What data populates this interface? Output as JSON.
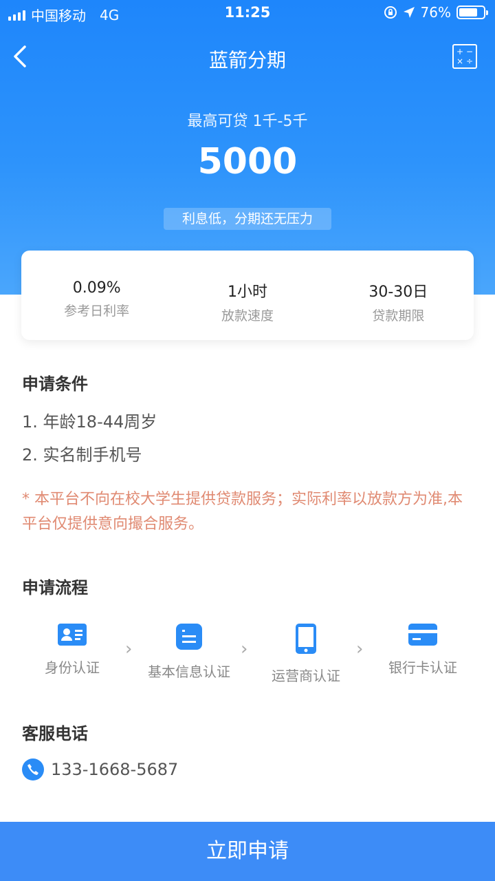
{
  "status_bar": {
    "carrier": "中国移动",
    "network": "4G",
    "time": "11:25",
    "battery": "76%",
    "battery_level": 0.76
  },
  "nav": {
    "title": "蓝箭分期"
  },
  "hero": {
    "subtitle": "最高可贷 1千-5千",
    "amount": "5000",
    "slogan": "利息低，分期还无压力"
  },
  "stats": [
    {
      "value": "0.09%",
      "label": "参考日利率"
    },
    {
      "value": "1小时",
      "label": "放款速度"
    },
    {
      "value": "30-30日",
      "label": "贷款期限"
    }
  ],
  "conditions": {
    "title": "申请条件",
    "items": [
      "1. 年龄18-44周岁",
      "2. 实名制手机号"
    ]
  },
  "notice": "* 本平台不向在校大学生提供贷款服务；实际利率以放款方为准,本平台仅提供意向撮合服务。",
  "process": {
    "title": "申请流程",
    "steps": [
      {
        "label": "身份认证",
        "icon": "id-card-icon"
      },
      {
        "label": "基本信息认证",
        "icon": "info-list-icon"
      },
      {
        "label": "运营商认证",
        "icon": "mobile-phone-icon"
      },
      {
        "label": "银行卡认证",
        "icon": "bank-card-icon"
      }
    ]
  },
  "service": {
    "title": "客服电话",
    "phone": "133-1668-5687"
  },
  "apply_button": {
    "label": "立即申请"
  },
  "colors": {
    "primary": "#2a8cf6",
    "notice": "#e08a72",
    "button": "#3d8cf7"
  }
}
